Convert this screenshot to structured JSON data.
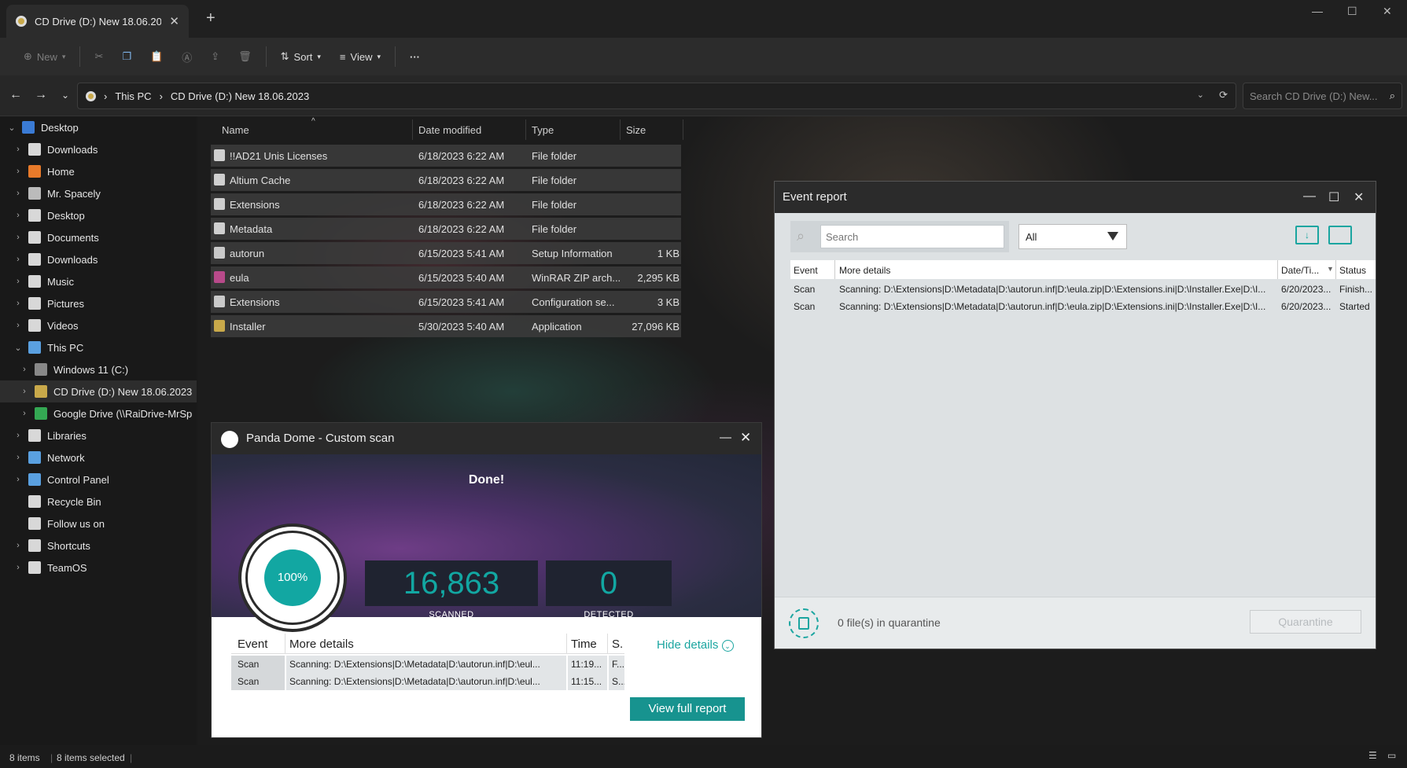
{
  "explorer": {
    "tab_title": "CD Drive (D:) New 18.06.20",
    "toolbar": {
      "new": "New",
      "sort": "Sort",
      "view": "View",
      "more": "···"
    },
    "breadcrumb": [
      "This PC",
      "CD Drive (D:) New 18.06.2023"
    ],
    "search_placeholder": "Search CD Drive (D:) New...",
    "sidebar": [
      {
        "label": "Desktop",
        "expanded": true
      },
      {
        "label": "Downloads"
      },
      {
        "label": "Home"
      },
      {
        "label": "Mr. Spacely"
      },
      {
        "label": "Desktop"
      },
      {
        "label": "Documents"
      },
      {
        "label": "Downloads"
      },
      {
        "label": "Music"
      },
      {
        "label": "Pictures"
      },
      {
        "label": "Videos"
      },
      {
        "label": "This PC",
        "expanded": true
      },
      {
        "label": "Windows 11 (C:)"
      },
      {
        "label": "CD Drive (D:) New 18.06.2023",
        "selected": true
      },
      {
        "label": "Google Drive (\\\\RaiDrive-MrSp"
      },
      {
        "label": "Libraries"
      },
      {
        "label": "Network"
      },
      {
        "label": "Control Panel"
      },
      {
        "label": "Recycle Bin"
      },
      {
        "label": "Follow us on"
      },
      {
        "label": "Shortcuts"
      },
      {
        "label": "TeamOS"
      }
    ],
    "columns": {
      "name": "Name",
      "date": "Date modified",
      "type": "Type",
      "size": "Size"
    },
    "files": [
      {
        "name": "!!AD21 Unis Licenses",
        "date": "6/18/2023 6:22 AM",
        "type": "File folder",
        "size": ""
      },
      {
        "name": "Altium Cache",
        "date": "6/18/2023 6:22 AM",
        "type": "File folder",
        "size": ""
      },
      {
        "name": "Extensions",
        "date": "6/18/2023 6:22 AM",
        "type": "File folder",
        "size": ""
      },
      {
        "name": "Metadata",
        "date": "6/18/2023 6:22 AM",
        "type": "File folder",
        "size": ""
      },
      {
        "name": "autorun",
        "date": "6/15/2023 5:41 AM",
        "type": "Setup Information",
        "size": "1 KB"
      },
      {
        "name": "eula",
        "date": "6/15/2023 5:40 AM",
        "type": "WinRAR ZIP arch...",
        "size": "2,295 KB"
      },
      {
        "name": "Extensions",
        "date": "6/15/2023 5:41 AM",
        "type": "Configuration se...",
        "size": "3 KB"
      },
      {
        "name": "Installer",
        "date": "5/30/2023 5:40 AM",
        "type": "Application",
        "size": "27,096 KB"
      }
    ],
    "status": {
      "count": "8 items",
      "selected": "8 items selected"
    }
  },
  "event_report": {
    "title": "Event report",
    "search_placeholder": "Search",
    "filter_value": "All",
    "columns": {
      "event": "Event",
      "details": "More details",
      "date": "Date/Ti...",
      "status": "Status"
    },
    "rows": [
      {
        "event": "Scan",
        "details": "Scanning: D:\\Extensions|D:\\Metadata|D:\\autorun.inf|D:\\eula.zip|D:\\Extensions.ini|D:\\Installer.Exe|D:\\I...",
        "date": "6/20/2023...",
        "status": "Finish..."
      },
      {
        "event": "Scan",
        "details": "Scanning: D:\\Extensions|D:\\Metadata|D:\\autorun.inf|D:\\eula.zip|D:\\Extensions.ini|D:\\Installer.Exe|D:\\I...",
        "date": "6/20/2023...",
        "status": "Started"
      }
    ],
    "quarantine_text": "0 file(s) in quarantine",
    "quarantine_button": "Quarantine"
  },
  "panda": {
    "title": "Panda Dome - Custom scan",
    "done": "Done!",
    "progress": "100%",
    "scanned_value": "16,863",
    "scanned_label": "SCANNED",
    "detected_value": "0",
    "detected_label": "DETECTED",
    "columns": {
      "event": "Event",
      "details": "More details",
      "time": "Time",
      "status": "S."
    },
    "rows": [
      {
        "event": "Scan",
        "details": "Scanning: D:\\Extensions|D:\\Metadata|D:\\autorun.inf|D:\\eul...",
        "time": "11:19...",
        "status": "F..."
      },
      {
        "event": "Scan",
        "details": "Scanning: D:\\Extensions|D:\\Metadata|D:\\autorun.inf|D:\\eul...",
        "time": "11:15...",
        "status": "S..."
      }
    ],
    "hide_details": "Hide details",
    "view_full_report": "View full report"
  },
  "colors": {
    "accent": "#12a7a2",
    "button": "#17938f"
  }
}
